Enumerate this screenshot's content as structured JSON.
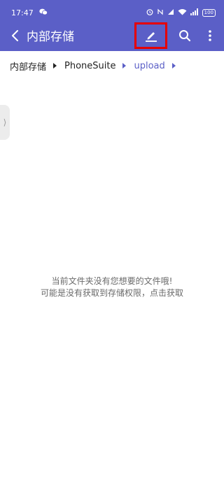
{
  "status_bar": {
    "time": "17:47",
    "battery": "100",
    "icons": [
      "wechat-icon",
      "alarm-icon",
      "nfc-icon",
      "signal-icon",
      "wifi-icon",
      "signal-bars-icon",
      "battery-icon"
    ]
  },
  "app_bar": {
    "title": "内部存储",
    "accent_color": "#5b5fc7",
    "highlight_color": "#e60000"
  },
  "breadcrumb": {
    "items": [
      "内部存储",
      "PhoneSuite",
      "upload"
    ]
  },
  "side_handle": {
    "glyph": "⟩"
  },
  "empty_state": {
    "line1": "当前文件夹没有您想要的文件哦!",
    "line2": "可能是没有获取到存储权限，点击获取"
  }
}
